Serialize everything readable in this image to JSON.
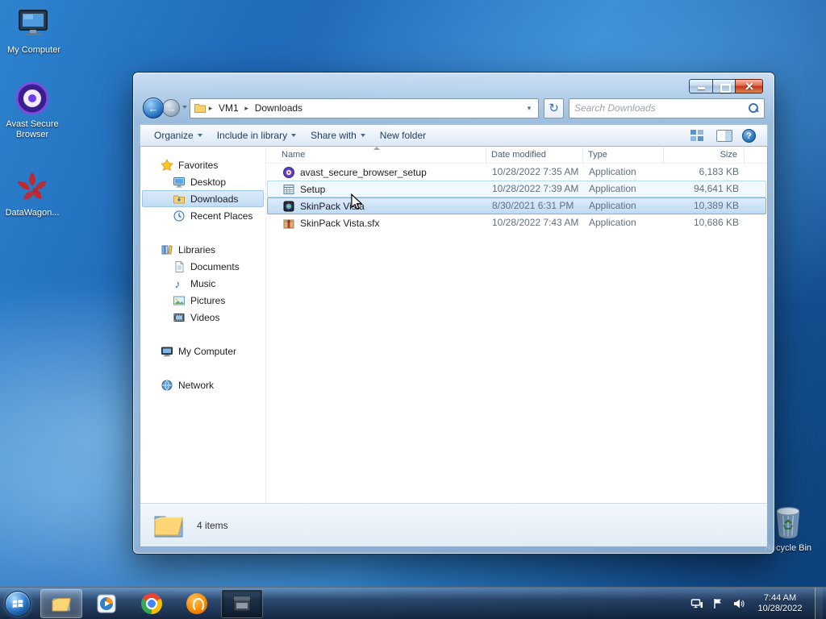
{
  "desktop": {
    "icons": [
      {
        "label": "My Computer"
      },
      {
        "label": "Avast Secure Browser"
      },
      {
        "label": "DataWagon..."
      },
      {
        "label": "Recycle Bin"
      }
    ]
  },
  "window": {
    "nav": {
      "breadcrumb_root": "VM1",
      "breadcrumb_current": "Downloads",
      "search_placeholder": "Search Downloads"
    },
    "toolbar": {
      "organize": "Organize",
      "include_in_library": "Include in library",
      "share_with": "Share with",
      "new_folder": "New folder"
    },
    "sidebar": {
      "sections": [
        {
          "label": "Favorites",
          "items": [
            {
              "label": "Desktop"
            },
            {
              "label": "Downloads"
            },
            {
              "label": "Recent Places"
            }
          ]
        },
        {
          "label": "Libraries",
          "items": [
            {
              "label": "Documents"
            },
            {
              "label": "Music"
            },
            {
              "label": "Pictures"
            },
            {
              "label": "Videos"
            }
          ]
        },
        {
          "label": "My Computer",
          "items": []
        },
        {
          "label": "Network",
          "items": []
        }
      ]
    },
    "list": {
      "columns": [
        {
          "label": "Name"
        },
        {
          "label": "Date modified"
        },
        {
          "label": "Type"
        },
        {
          "label": "Size"
        }
      ],
      "files": [
        {
          "name": "avast_secure_browser_setup",
          "date_modified": "10/28/2022 7:35 AM",
          "type": "Application",
          "size": "6,183 KB"
        },
        {
          "name": "Setup",
          "date_modified": "10/28/2022 7:39 AM",
          "type": "Application",
          "size": "94,641 KB"
        },
        {
          "name": "SkinPack Vista",
          "date_modified": "8/30/2021 6:31 PM",
          "type": "Application",
          "size": "10,389 KB"
        },
        {
          "name": "SkinPack Vista.sfx",
          "date_modified": "10/28/2022 7:43 AM",
          "type": "Application",
          "size": "10,686 KB"
        }
      ]
    },
    "statusbar": {
      "items_count": "4 items"
    }
  },
  "taskbar": {
    "clock": {
      "time": "7:44 AM",
      "date": "10/28/2022"
    }
  },
  "colors": {
    "accent": "#2b78c8",
    "selection": "#c1dbf5",
    "taskbar": "#1a2c48"
  }
}
